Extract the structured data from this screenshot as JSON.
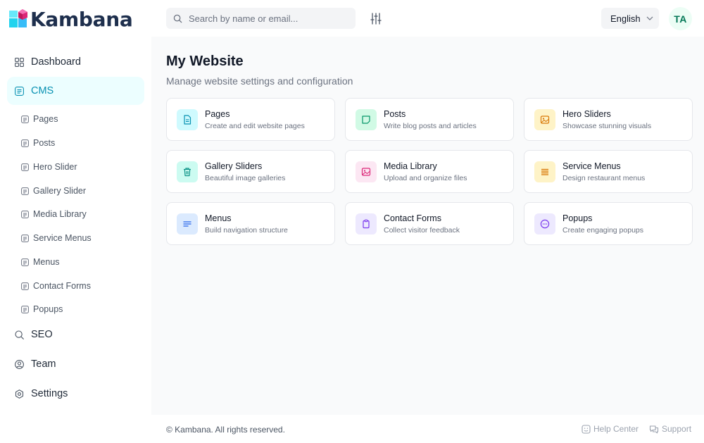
{
  "app": {
    "logo_text": "Kambana"
  },
  "header": {
    "search_placeholder": "Search by name or email...",
    "language": "English",
    "avatar_initials": "TA"
  },
  "sidebar": {
    "items": [
      {
        "label": "Dashboard",
        "icon": "grid-icon"
      },
      {
        "label": "CMS",
        "icon": "cms-icon",
        "active": true
      },
      {
        "label": "SEO",
        "icon": "search-icon"
      },
      {
        "label": "Team",
        "icon": "user-circle-icon"
      },
      {
        "label": "Settings",
        "icon": "gear-icon"
      }
    ],
    "cms_sub": [
      {
        "label": "Pages"
      },
      {
        "label": "Posts"
      },
      {
        "label": "Hero Slider"
      },
      {
        "label": "Gallery Slider"
      },
      {
        "label": "Media Library"
      },
      {
        "label": "Service Menus"
      },
      {
        "label": "Menus"
      },
      {
        "label": "Contact Forms"
      },
      {
        "label": "Popups"
      }
    ]
  },
  "main": {
    "title": "My Website",
    "subtitle": "Manage website settings and configuration",
    "cards": [
      {
        "title": "Pages",
        "desc": "Create and edit website pages",
        "icon": "document-icon",
        "color": "#0891b2",
        "bg": "#cffafe"
      },
      {
        "title": "Posts",
        "desc": "Write blog posts and articles",
        "icon": "note-icon",
        "color": "#059669",
        "bg": "#d1fae5"
      },
      {
        "title": "Hero Sliders",
        "desc": "Showcase stunning visuals",
        "icon": "image-icon",
        "color": "#d97706",
        "bg": "#fef3c7"
      },
      {
        "title": "Gallery Sliders",
        "desc": "Beautiful image galleries",
        "icon": "trash-icon",
        "color": "#0d9488",
        "bg": "#ccfbf1"
      },
      {
        "title": "Media Library",
        "desc": "Upload and organize files",
        "icon": "image-icon",
        "color": "#db2777",
        "bg": "#fce7f3"
      },
      {
        "title": "Service Menus",
        "desc": "Design restaurant menus",
        "icon": "list-icon",
        "color": "#d97706",
        "bg": "#fef3c7"
      },
      {
        "title": "Menus",
        "desc": "Build navigation structure",
        "icon": "menu-lines-icon",
        "color": "#2563eb",
        "bg": "#dbeafe"
      },
      {
        "title": "Contact Forms",
        "desc": "Collect visitor feedback",
        "icon": "clipboard-icon",
        "color": "#7c3aed",
        "bg": "#ede9fe"
      },
      {
        "title": "Popups",
        "desc": "Create engaging popups",
        "icon": "dots-circle-icon",
        "color": "#7c3aed",
        "bg": "#ede9fe"
      }
    ]
  },
  "footer": {
    "copyright": "© Kambana. All rights reserved.",
    "help": "Help Center",
    "support": "Support"
  },
  "colors": {
    "accent": "#0891b2",
    "brand_text": "#1e2f4d",
    "active_bg": "#ecfeff"
  }
}
